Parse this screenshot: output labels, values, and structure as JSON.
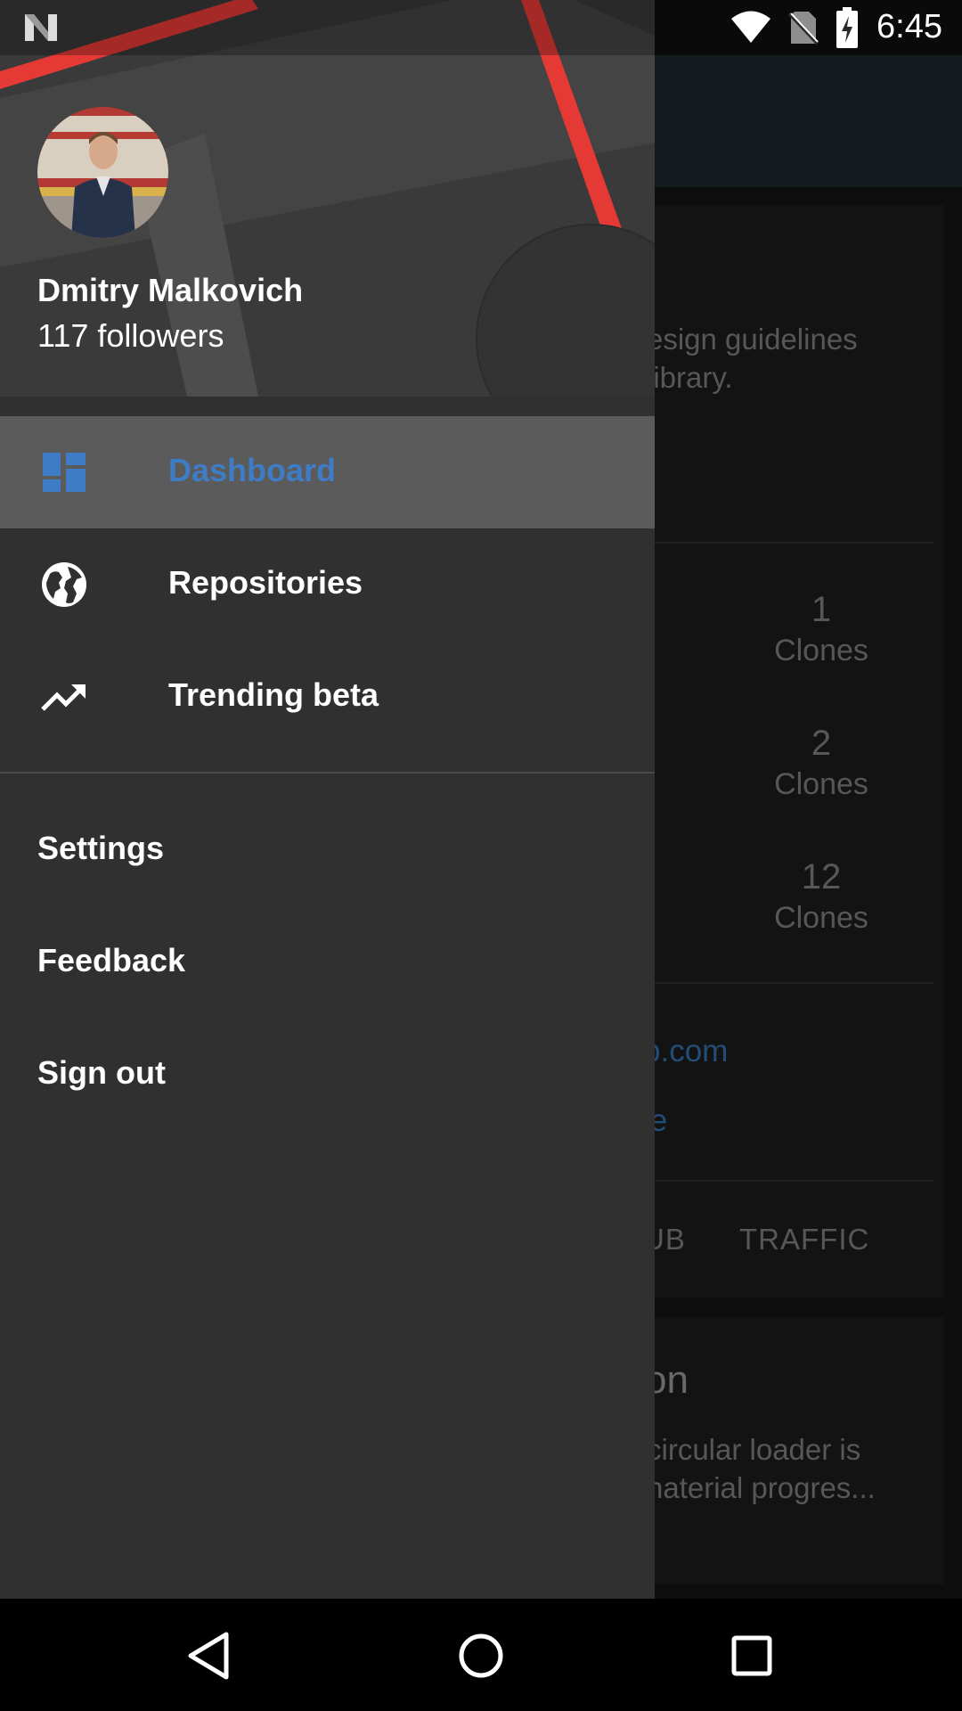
{
  "status_bar": {
    "time": "6:45"
  },
  "background_app": {
    "description_lines": [
      "esign guidelines",
      " library."
    ],
    "stats": [
      {
        "value": "1",
        "label": "Clones"
      },
      {
        "value": "2",
        "label": "Clones"
      },
      {
        "value": "12",
        "label": "Clones"
      }
    ],
    "links": [
      "b.com",
      "le"
    ],
    "tabs": [
      "UB",
      "TRAFFIC"
    ],
    "card2": {
      "title": "on",
      "lines": [
        "circular loader is",
        "naterial progres..."
      ]
    }
  },
  "drawer": {
    "user": {
      "name": "Dmitry Malkovich",
      "followers": "117 followers"
    },
    "nav_items": [
      {
        "label": "Dashboard",
        "icon": "dashboard-icon",
        "active": true
      },
      {
        "label": "Repositories",
        "icon": "globe-icon",
        "active": false
      },
      {
        "label": "Trending beta",
        "icon": "trending-up-icon",
        "active": false
      }
    ],
    "secondary_items": [
      {
        "label": "Settings"
      },
      {
        "label": "Feedback"
      },
      {
        "label": "Sign out"
      }
    ]
  },
  "colors": {
    "accent": "#3f7cc6",
    "header_stripe": "#e53935",
    "drawer_bg": "#303030"
  }
}
